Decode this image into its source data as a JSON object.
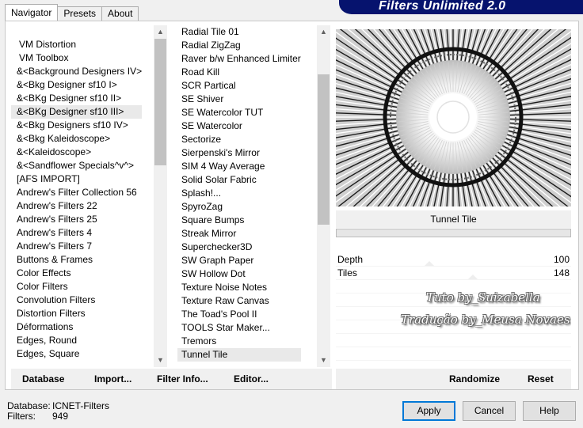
{
  "tabs": [
    {
      "label": "Navigator",
      "active": true
    },
    {
      "label": "Presets",
      "active": false
    },
    {
      "label": "About",
      "active": false
    }
  ],
  "banner": {
    "title": "Filters Unlimited 2.0",
    "color": "#06136e"
  },
  "categories": {
    "items": [
      "VM Distortion",
      "VM Toolbox",
      "&<Background Designers IV>",
      "&<Bkg Designer sf10 I>",
      "&<BKg Designer sf10 II>",
      "&<BKg Designer sf10 III>",
      "&<Bkg Designers sf10 IV>",
      "&<Bkg Kaleidoscope>",
      "&<Kaleidoscope>",
      "&<Sandflower Specials^v^>",
      "[AFS IMPORT]",
      "Andrew's Filter Collection 56",
      "Andrew's Filters 22",
      "Andrew's Filters 25",
      "Andrew's Filters 4",
      "Andrew's Filters 7",
      "Buttons & Frames",
      "Color Effects",
      "Color Filters",
      "Convolution Filters",
      "Distortion Filters",
      "Déformations",
      "Edges, Round",
      "Edges, Square"
    ],
    "selected_index": 5
  },
  "filters": {
    "items": [
      "Radial Tile 01",
      "Radial ZigZag",
      "Raver b/w Enhanced Limiter",
      "Road Kill",
      "SCR  Partical",
      "SE Shiver",
      "SE Watercolor TUT",
      "SE Watercolor",
      "Sectorize",
      "Sierpenski's Mirror",
      "SIM 4 Way Average",
      "Solid Solar Fabric",
      "Splash!...",
      "SpyroZag",
      "Square Bumps",
      "Streak Mirror",
      "Superchecker3D",
      "SW Graph Paper",
      "SW Hollow Dot",
      "Texture Noise Notes",
      "Texture Raw Canvas",
      "The Toad's Pool II",
      "TOOLS Star Maker...",
      "Tremors",
      "Tunnel Tile"
    ],
    "selected_index": 24
  },
  "preview": {
    "filter_name": "Tunnel Tile"
  },
  "params": [
    {
      "name": "Depth",
      "value": "100"
    },
    {
      "name": "Tiles",
      "value": "148"
    }
  ],
  "watermark": {
    "line1": "Tuto by_Suizabella",
    "line2": "Tradução by_Meusa Novaes"
  },
  "toolbar": {
    "database": "Database",
    "import": "Import...",
    "filter_info": "Filter Info...",
    "editor": "Editor...",
    "randomize": "Randomize",
    "reset": "Reset"
  },
  "info": {
    "database_label": "Database:",
    "database_value": "ICNET-Filters",
    "filters_label": "Filters:",
    "filters_value": "949"
  },
  "buttons": {
    "apply": "Apply",
    "cancel": "Cancel",
    "help": "Help"
  }
}
